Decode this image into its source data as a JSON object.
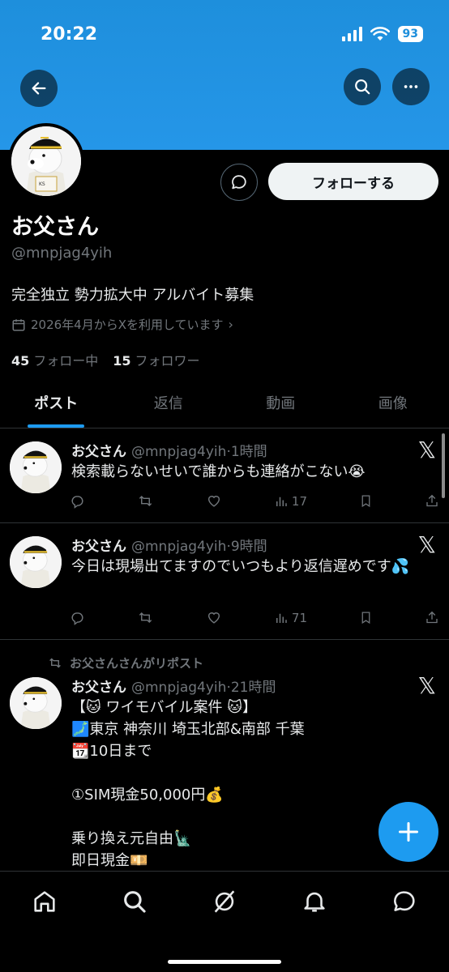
{
  "status": {
    "time": "20:22",
    "battery": "93"
  },
  "colors": {
    "banner": "#2596e8",
    "accent": "#1d9bf0"
  },
  "profile": {
    "name": "お父さん",
    "handle": "@mnpjag4yih",
    "bio": "完全独立 勢力拡大中 アルバイト募集",
    "joined": "2026年4月からXを利用しています",
    "following_count": "45",
    "following_label": "フォロー中",
    "followers_count": "15",
    "followers_label": "フォロワー",
    "follow_button": "フォローする"
  },
  "tabs": [
    "ポスト",
    "返信",
    "動画",
    "画像"
  ],
  "posts": [
    {
      "name": "お父さん",
      "handle": "@mnpjag4yih",
      "time": "1時間",
      "text": "検索載らないせいで誰からも連絡がこない😭",
      "views": "17"
    },
    {
      "name": "お父さん",
      "handle": "@mnpjag4yih",
      "time": "9時間",
      "text": "今日は現場出てますのでいつもより返信遅めです💦",
      "views": "71"
    },
    {
      "repost_label": "お父さんさんがリポスト",
      "name": "お父さん",
      "handle": "@mnpjag4yih",
      "time": "21時間",
      "text": "【🐱 ワイモバイル案件 🐱】\n🗾東京 神奈川 埼玉北部&南部 千葉\n📆10日まで\n\n①SIM現金50,000円💰\n\n乗り換え元自由🗽\n即日現金💴"
    }
  ],
  "icons": {
    "back": "back-arrow-icon",
    "search": "search-icon",
    "more": "more-icon",
    "message": "message-icon",
    "calendar": "calendar-icon",
    "x_logo": "x-logo-icon",
    "reply": "reply-icon",
    "repost": "repost-icon",
    "like": "like-icon",
    "views": "views-icon",
    "bookmark": "bookmark-icon",
    "share": "share-icon",
    "compose": "plus-icon",
    "home": "home-icon",
    "explore": "explore-icon",
    "grok": "grok-icon",
    "notifications": "bell-icon",
    "messages": "chat-icon"
  }
}
